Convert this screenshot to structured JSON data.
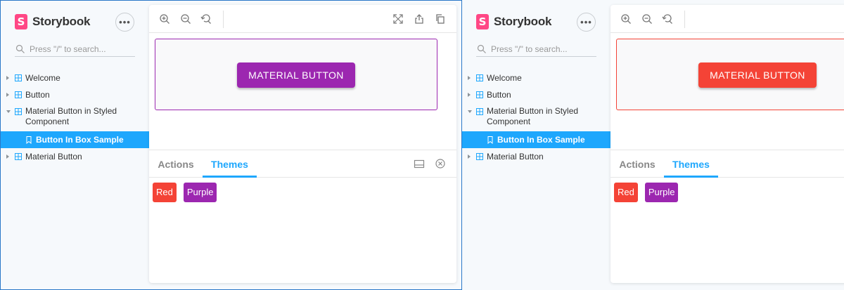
{
  "brand": {
    "name": "Storybook",
    "logo_letter": "S"
  },
  "search": {
    "placeholder": "Press \"/\" to search..."
  },
  "tree": [
    {
      "label": "Welcome",
      "kind": "component",
      "expanded": false
    },
    {
      "label": "Button",
      "kind": "component",
      "expanded": false
    },
    {
      "label": "Material Button in Styled Component",
      "kind": "component",
      "expanded": true
    },
    {
      "label": "Button In Box Sample",
      "kind": "story",
      "selected": true
    },
    {
      "label": "Material Button",
      "kind": "component",
      "expanded": false
    }
  ],
  "toolbar": {
    "icons": [
      "zoom-in-icon",
      "zoom-out-icon",
      "zoom-reset-icon",
      "fullscreen-icon",
      "share-icon",
      "copy-icon"
    ]
  },
  "preview": {
    "button_label": "MATERIAL BUTTON"
  },
  "addons": {
    "tabs": [
      "Actions",
      "Themes"
    ],
    "active_tab": "Themes",
    "icons": [
      "panel-orientation-icon",
      "close-panel-icon"
    ]
  },
  "themes": [
    {
      "label": "Red",
      "color": "#f44336"
    },
    {
      "label": "Purple",
      "color": "#9c27b0"
    }
  ],
  "panes": [
    {
      "active_theme": "Purple",
      "accent": "#9c27b0"
    },
    {
      "active_theme": "Red",
      "accent": "#f44336"
    }
  ],
  "colors": {
    "storybook_pink": "#ff4785",
    "selection_blue": "#1ea7fd"
  }
}
